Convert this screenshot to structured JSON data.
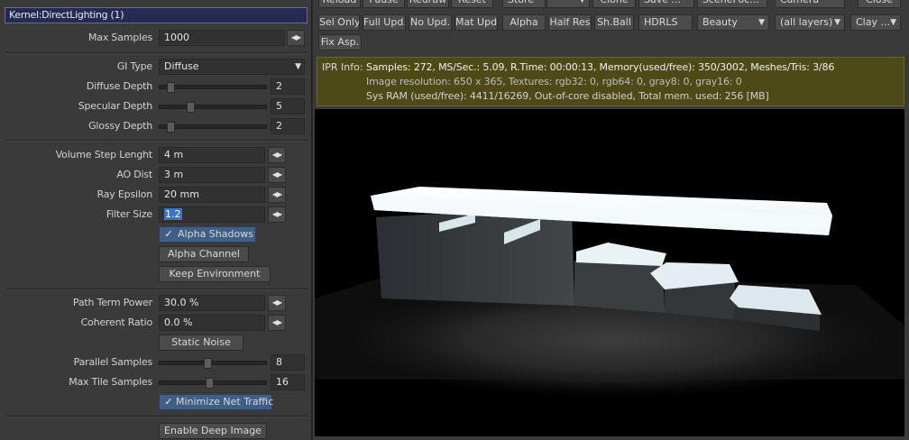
{
  "panel": {
    "title": "Kernel:DirectLighting (1)",
    "max_samples": {
      "label": "Max Samples",
      "value": "1000"
    },
    "gi_type": {
      "label": "GI Type",
      "value": "Diffuse"
    },
    "diffuse_depth": {
      "label": "Diffuse Depth",
      "value": "2",
      "fraction": 0.08
    },
    "specular_depth": {
      "label": "Specular Depth",
      "value": "5",
      "fraction": 0.28
    },
    "glossy_depth": {
      "label": "Glossy Depth",
      "value": "2",
      "fraction": 0.08
    },
    "volume_step": {
      "label": "Volume Step Lenght",
      "value": "4 m"
    },
    "ao_dist": {
      "label": "AO Dist",
      "value": "3 m"
    },
    "ray_epsilon": {
      "label": "Ray Epsilon",
      "value": "20 mm"
    },
    "filter_size": {
      "label": "Filter Size",
      "value": "1.2"
    },
    "alpha_shadows": {
      "label": "Alpha Shadows",
      "checked": true
    },
    "alpha_channel": {
      "label": "Alpha Channel"
    },
    "keep_environment": {
      "label": "Keep Environment"
    },
    "path_term_power": {
      "label": "Path Term Power",
      "value": "30.0 %"
    },
    "coherent_ratio": {
      "label": "Coherent Ratio",
      "value": "0.0 %"
    },
    "static_noise": {
      "label": "Static Noise"
    },
    "parallel_samples": {
      "label": "Parallel Samples",
      "value": "8",
      "fraction": 0.45
    },
    "max_tile_samples": {
      "label": "Max Tile Samples",
      "value": "16",
      "fraction": 0.47
    },
    "minimize_net_traffic": {
      "label": "Minimize Net Traffic",
      "checked": true
    },
    "enable_deep_image": {
      "label": "Enable Deep Image"
    }
  },
  "toolbar": {
    "row0": [
      "Reload",
      "Pause",
      "Redraw",
      "Reset",
      "Store",
      "",
      "Clone",
      "Save ...",
      "SceneFoc...",
      "Camera",
      "Close"
    ],
    "row1": {
      "sel_only": "Sel Only",
      "full_upd": "Full Upd.",
      "no_upd": "No Upd.",
      "mat_upd": "Mat Upd",
      "alpha": "Alpha",
      "half_res": "Half Res",
      "sh_ball": "Sh.Ball",
      "hdrls": "HDRLS",
      "beauty": "Beauty",
      "layers": "(all layers)",
      "clay": "Clay ..."
    },
    "fix_asp": "Fix Asp."
  },
  "ipr": {
    "label": "IPR Info:",
    "line1": "Samples: 272, MS/Sec.: 5.09, R.Time: 00:00:13, Memory(used/free): 350/3002, Meshes/Tris: 3/86",
    "line2": "Image resolution: 650 x 365, Textures: rgb32: 0, rgb64: 0, gray8: 0, gray16: 0",
    "line3": "Sys RAM (used/free): 4411/16269, Out-of-core disabled, Total mem. used: 256 [MB]"
  },
  "colors": {
    "title_bar": "#242a52",
    "ipr_bg": "#4e4a17",
    "checked": "#3f5f86"
  },
  "icons": {
    "updown": "updown-arrows-icon",
    "dropdown": "chevron-down-icon",
    "check": "checkmark-icon"
  }
}
